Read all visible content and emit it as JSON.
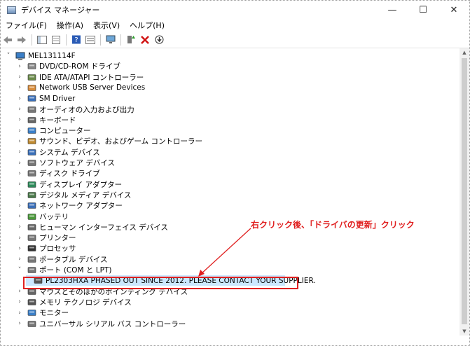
{
  "window": {
    "title": "デバイス マネージャー",
    "minimize": "—",
    "maximize": "☐",
    "close": "✕"
  },
  "menu": [
    "ファイル(F)",
    "操作(A)",
    "表示(V)",
    "ヘルプ(H)"
  ],
  "tree": {
    "root": "MEL131114F",
    "items": [
      {
        "label": "DVD/CD-ROM ドライブ",
        "icon": "dvd-drive-icon",
        "expanded": false
      },
      {
        "label": "IDE ATA/ATAPI コントローラー",
        "icon": "ide-controller-icon",
        "expanded": false
      },
      {
        "label": "Network USB Server Devices",
        "icon": "usb-server-icon",
        "expanded": false
      },
      {
        "label": "SM Driver",
        "icon": "sm-driver-icon",
        "expanded": false
      },
      {
        "label": "オーディオの入力および出力",
        "icon": "audio-icon",
        "expanded": false
      },
      {
        "label": "キーボード",
        "icon": "keyboard-icon",
        "expanded": false
      },
      {
        "label": "コンピューター",
        "icon": "computer-icon",
        "expanded": false
      },
      {
        "label": "サウンド、ビデオ、およびゲーム コントローラー",
        "icon": "sound-icon",
        "expanded": false
      },
      {
        "label": "システム デバイス",
        "icon": "system-device-icon",
        "expanded": false
      },
      {
        "label": "ソフトウェア デバイス",
        "icon": "software-device-icon",
        "expanded": false
      },
      {
        "label": "ディスク ドライブ",
        "icon": "disk-drive-icon",
        "expanded": false
      },
      {
        "label": "ディスプレイ アダプター",
        "icon": "display-adapter-icon",
        "expanded": false
      },
      {
        "label": "デジタル メディア デバイス",
        "icon": "digital-media-icon",
        "expanded": false
      },
      {
        "label": "ネットワーク アダプター",
        "icon": "network-adapter-icon",
        "expanded": false
      },
      {
        "label": "バッテリ",
        "icon": "battery-icon",
        "expanded": false
      },
      {
        "label": "ヒューマン インターフェイス デバイス",
        "icon": "hid-icon",
        "expanded": false
      },
      {
        "label": "プリンター",
        "icon": "printer-icon",
        "expanded": false
      },
      {
        "label": "プロセッサ",
        "icon": "processor-icon",
        "expanded": false
      },
      {
        "label": "ポータブル デバイス",
        "icon": "portable-device-icon",
        "expanded": false
      },
      {
        "label": "ポート (COM と LPT)",
        "icon": "port-icon",
        "expanded": true
      },
      {
        "label": "PL2303HXA PHASED OUT SINCE 2012. PLEASE CONTACT YOUR SUPPLIER.",
        "icon": "port-device-icon",
        "child": true
      },
      {
        "label": "マウスとそのほかのポインティング デバイス",
        "icon": "mouse-icon",
        "expanded": false
      },
      {
        "label": "メモリ テクノロジ デバイス",
        "icon": "memory-icon",
        "expanded": false
      },
      {
        "label": "モニター",
        "icon": "monitor-icon",
        "expanded": false
      },
      {
        "label": "ユニバーサル シリアル バス コントローラー",
        "icon": "usb-controller-icon",
        "expanded": false
      }
    ]
  },
  "annotation": {
    "text": "右クリック後、「ドライバの更新」クリック",
    "color": "#e02020"
  },
  "colors": {
    "selection": "#cce8ff",
    "annotation": "#e02020"
  }
}
